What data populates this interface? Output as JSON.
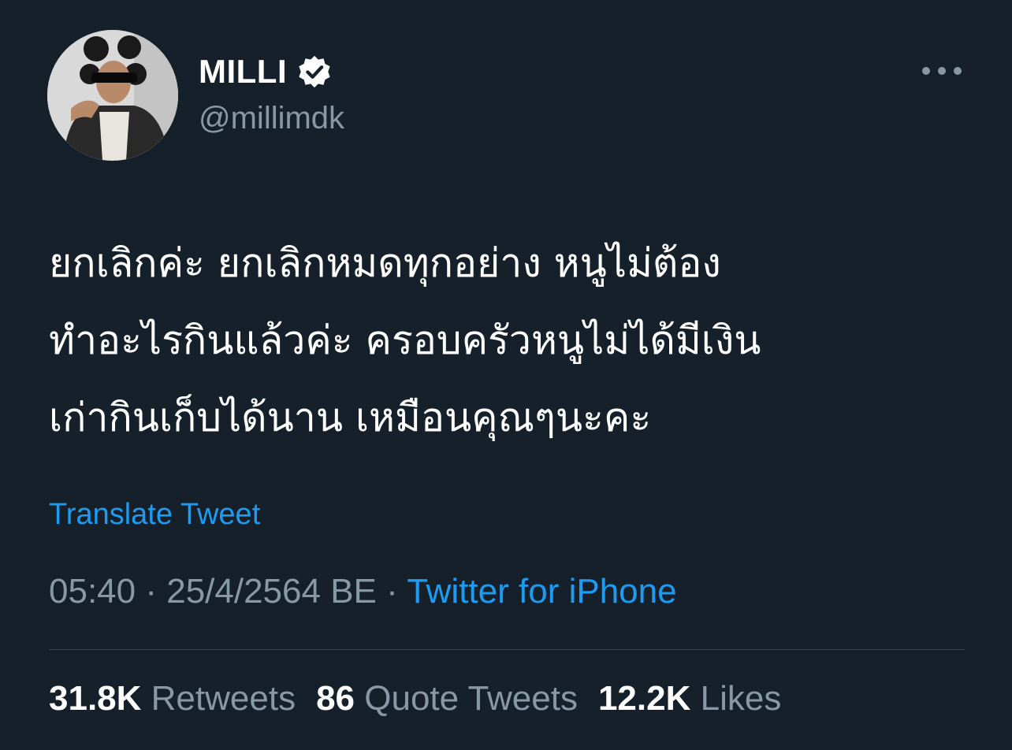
{
  "author": {
    "display_name": "MILLI",
    "handle": "@millimdk",
    "verified": true,
    "avatar_icon": "profile-photo"
  },
  "tweet": {
    "lines": [
      "ยกเลิกค่ะ ยกเลิกหมดทุกอย่าง หนูไม่ต้อง",
      "ทำอะไรกินแล้วค่ะ ครอบครัวหนูไม่ได้มีเงิน",
      "เก่ากินเก็บได้นาน เหมือนคุณๆนะคะ"
    ]
  },
  "translate_label": "Translate Tweet",
  "meta": {
    "time": "05:40",
    "separator": " · ",
    "date": "25/4/2564 BE",
    "source": "Twitter for iPhone"
  },
  "stats": {
    "retweets": {
      "count": "31.8K",
      "label": "Retweets"
    },
    "quotes": {
      "count": "86",
      "label": "Quote Tweets"
    },
    "likes": {
      "count": "12.2K",
      "label": "Likes"
    }
  },
  "colors": {
    "background": "#15202b",
    "accent": "#1d9bf0",
    "secondary_text": "#8899a6"
  }
}
